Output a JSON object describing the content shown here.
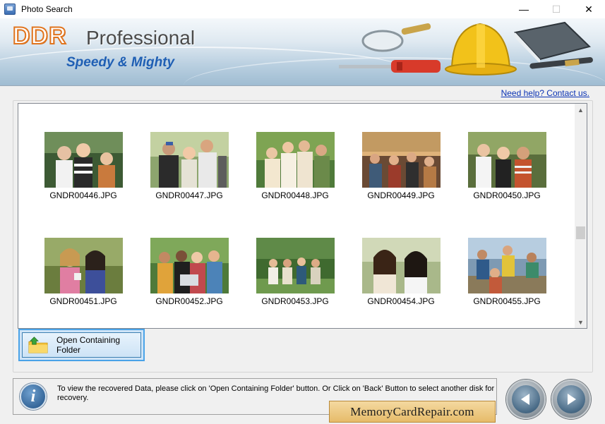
{
  "window": {
    "title": "Photo Search",
    "minimize": "—",
    "maximize": "☐",
    "close": "✕"
  },
  "banner": {
    "brand": "DDR",
    "product": "Professional",
    "tagline": "Speedy & Mighty"
  },
  "help_link": "Need help? Contact us.",
  "photos": [
    {
      "name": "GNDR00446.JPG"
    },
    {
      "name": "GNDR00447.JPG"
    },
    {
      "name": "GNDR00448.JPG"
    },
    {
      "name": "GNDR00449.JPG"
    },
    {
      "name": "GNDR00450.JPG"
    },
    {
      "name": "GNDR00451.JPG"
    },
    {
      "name": "GNDR00452.JPG"
    },
    {
      "name": "GNDR00453.JPG"
    },
    {
      "name": "GNDR00454.JPG"
    },
    {
      "name": "GNDR00455.JPG"
    }
  ],
  "folder_button": "Open Containing Folder",
  "info": {
    "text": "To view the recovered Data, please click on 'Open Containing Folder' button. Or Click on 'Back' Button to select another disk for recovery."
  },
  "watermark": "MemoryCardRepair.com",
  "colors": {
    "brand_orange": "#e0741e",
    "tagline_blue": "#1f5fb4",
    "link_blue": "#0a32b4",
    "selection_blue": "#4aa3e8"
  }
}
